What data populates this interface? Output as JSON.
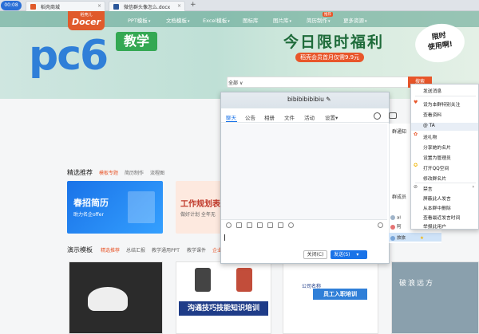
{
  "browser": {
    "recorder_time": "00:08",
    "tabs": [
      {
        "label": "稻壳商城",
        "icon": "docer-icon",
        "close": "×"
      },
      {
        "label": "微信群头像怎么.docx",
        "icon": "word-doc-icon",
        "close": "×"
      }
    ],
    "new_tab": "+"
  },
  "site": {
    "logo_text": "Docer",
    "logo_cn": "稻壳儿",
    "brand": "pc6",
    "brand_badge": "教学",
    "nav": [
      {
        "label": "PPT模板"
      },
      {
        "label": "文档模板"
      },
      {
        "label": "Excel模板"
      },
      {
        "label": "图标库"
      },
      {
        "label": "图片库"
      },
      {
        "label": "简历制作",
        "badge": "推荐"
      },
      {
        "label": "更多资源"
      }
    ],
    "nav_chevron": "▾",
    "promo_title": "今日限时福利",
    "promo_sub": "稻壳会员首月仅需9.9元",
    "bubble_text": "限时\n使用啊!",
    "search": {
      "category": "全部",
      "chevron": "∨",
      "button": "搜索"
    },
    "section1": {
      "title": "精选推荐",
      "tabs": [
        "模板专题",
        "简历制作",
        "流程图"
      ],
      "active_tab": 0
    },
    "card1": {
      "title": "春招简历",
      "sub": "助力名企offer"
    },
    "card2": {
      "title": "工作规划表",
      "sub": "做好计划 全年无"
    },
    "section2": {
      "title": "演示模板",
      "tabs": [
        "精选推荐",
        "总结汇报",
        "教学通用PPT",
        "教学课件",
        "企业"
      ],
      "active_tab": 0
    },
    "thumbs": [
      {
        "label": ""
      },
      {
        "label": "沟通技巧技能知识培训"
      },
      {
        "label": "员工入职培训",
        "caption": "公司名称"
      },
      {
        "label": "破浪远方"
      }
    ]
  },
  "chat": {
    "title": "bibibibibibiu",
    "edit_icon": "✎",
    "tabs": [
      "聊天",
      "公告",
      "相册",
      "文件",
      "活动",
      "设置"
    ],
    "settings_chevron": "▾",
    "active_tab": 0,
    "close_button": "关闭(C)",
    "send_button": "发送(S)",
    "send_chevron": "▾",
    "group_notice": "群通知",
    "members_label": "群成员",
    "members": [
      "al",
      "阿",
      "bibi",
      "旅旅"
    ]
  },
  "context_menu": {
    "items": [
      {
        "label": "发送消息",
        "icon": ""
      },
      {
        "label": "设为本群特别关注",
        "icon": "heart-icon"
      },
      {
        "label": "查看资料",
        "icon": ""
      },
      {
        "label": "@ TA",
        "icon": ""
      },
      {
        "label": "送礼物",
        "icon": "gift-icon"
      },
      {
        "label": "分享她的名片",
        "icon": ""
      },
      {
        "label": "设置为管理员",
        "icon": ""
      },
      {
        "label": "打开QQ空间",
        "icon": "star-icon"
      },
      {
        "label": "修改群名片",
        "icon": ""
      },
      {
        "label": "禁言",
        "icon": "mute-icon",
        "submenu": "›"
      },
      {
        "label": "屏蔽此人发言",
        "icon": ""
      },
      {
        "label": "从本群中删除",
        "icon": ""
      },
      {
        "label": "查看最近发言时间",
        "icon": ""
      },
      {
        "label": "举报此用户",
        "icon": ""
      }
    ]
  },
  "colors": {
    "accent": "#1a73e8",
    "brand_orange": "#e8562a",
    "green": "#34a853"
  }
}
